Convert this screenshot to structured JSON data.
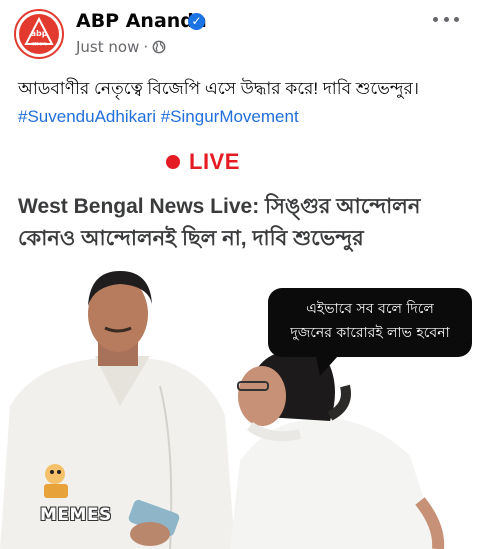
{
  "post": {
    "page_name": "ABP Ananda",
    "avatar_text_top": "abp",
    "avatar_text_bottom": "আনন্দ",
    "time": "Just now",
    "separator": "·",
    "caption_text": "আডবাণীর নেতৃত্বে বিজেপি এসে উদ্ধার করে! দাবি শুভেন্দুর।",
    "hashtags": [
      "#SuvenduAdhikari",
      "#SingurMovement"
    ]
  },
  "image": {
    "live_label": "LIVE",
    "headline": "West Bengal News Live: সিঙ্গুর আন্দোলন কোনও আন্দোলনই ছিল না, দাবি শুভেন্দুর",
    "bubble_line1": "এইভাবে সব বলে দিলে",
    "bubble_line2": "দুজনের কারোরই লাভ হবেনা",
    "watermark": "MEMES"
  },
  "icons": {
    "verified": "verified-badge-icon",
    "privacy": "globe-icon",
    "more": "more-options-icon"
  },
  "colors": {
    "link": "#216fdb",
    "live": "#e41b23",
    "brand": "#e23a2e",
    "verified": "#1b74e4"
  }
}
